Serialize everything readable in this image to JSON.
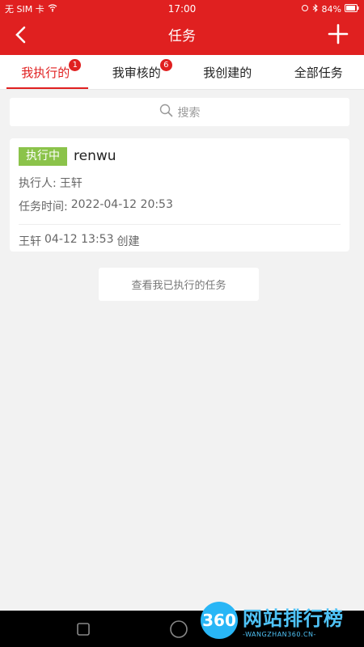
{
  "status_bar": {
    "carrier": "无 SIM 卡",
    "time": "17:00",
    "battery": "84%"
  },
  "nav": {
    "title": "任务",
    "back_icon": "chevron-left-icon",
    "add_icon": "plus-icon"
  },
  "tabs": [
    {
      "label": "我执行的",
      "badge": "1",
      "active": true
    },
    {
      "label": "我审核的",
      "badge": "6",
      "active": false
    },
    {
      "label": "我创建的",
      "badge": "",
      "active": false
    },
    {
      "label": "全部任务",
      "badge": "",
      "active": false
    }
  ],
  "search": {
    "placeholder": "搜索",
    "icon": "search-icon"
  },
  "task": {
    "status": "执行中",
    "name": "renwu",
    "executor_label": "执行人:",
    "executor": "王轩",
    "time_label": "任务时间:",
    "time": "2022-04-12 20:53",
    "creator": "王轩",
    "created_at": "04-12 13:53",
    "created_suffix": "创建"
  },
  "view_more": "查看我已执行的任务",
  "watermark": {
    "logo_text": "360",
    "title": "网站排行榜",
    "subtitle": "-WANGZHAN360.CN-"
  },
  "colors": {
    "brand": "#e02020",
    "status_green": "#8bc34a",
    "watermark_blue": "#29b6f6"
  }
}
